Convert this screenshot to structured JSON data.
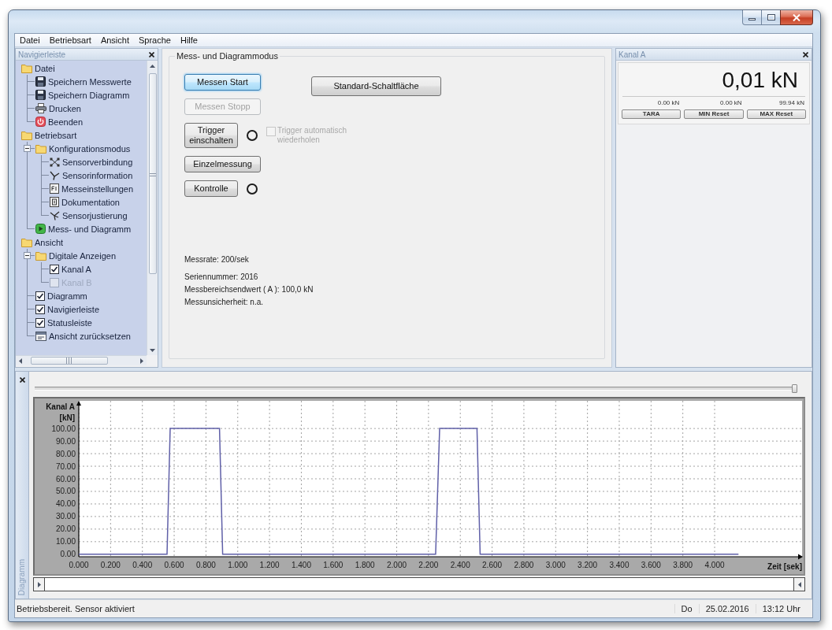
{
  "menu": [
    "Datei",
    "Betriebsart",
    "Ansicht",
    "Sprache",
    "Hilfe"
  ],
  "navigation": {
    "title": "Navigierleiste",
    "tree": [
      {
        "label": "Datei",
        "kind": "folder",
        "children": [
          {
            "label": "Speichern Messwerte",
            "kind": "save"
          },
          {
            "label": "Speichern Diagramm",
            "kind": "save"
          },
          {
            "label": "Drucken",
            "kind": "print"
          },
          {
            "label": "Beenden",
            "kind": "quit"
          }
        ]
      },
      {
        "label": "Betriebsart",
        "kind": "folder",
        "children": [
          {
            "label": "Konfigurationsmodus",
            "kind": "folder",
            "expanded": true,
            "children": [
              {
                "label": "Sensorverbindung",
                "kind": "connection"
              },
              {
                "label": "Sensorinformation",
                "kind": "information"
              },
              {
                "label": "Messeinstellungen",
                "kind": "settings"
              },
              {
                "label": "Dokumentation",
                "kind": "documentation"
              },
              {
                "label": "Sensorjustierung",
                "kind": "adjustment"
              }
            ]
          },
          {
            "label": "Mess- und Diagramm",
            "kind": "start"
          }
        ]
      },
      {
        "label": "Ansicht",
        "kind": "folder",
        "children": [
          {
            "label": "Digitale Anzeigen",
            "kind": "folder",
            "expanded": true,
            "children": [
              {
                "label": "Kanal A",
                "kind": "toggle",
                "checked": true,
                "disabled": false
              },
              {
                "label": "Kanal B",
                "kind": "toggle",
                "checked": false,
                "disabled": true
              }
            ]
          },
          {
            "label": "Diagramm",
            "kind": "toggle",
            "checked": true,
            "disabled": false
          },
          {
            "label": "Navigierleiste",
            "kind": "toggle",
            "checked": true,
            "disabled": false
          },
          {
            "label": "Statusleiste",
            "kind": "toggle",
            "checked": true,
            "disabled": false
          },
          {
            "label": "Ansicht zurücksetzen",
            "kind": "reset"
          }
        ]
      }
    ]
  },
  "mode_panel": {
    "title": "Mess- und Diagrammodus",
    "standard_button": "Standard-Schaltfläche",
    "controls": [
      {
        "kind": "button",
        "label": "Messen Start",
        "focused": true,
        "disabled": false
      },
      {
        "kind": "button",
        "label": "Messen Stopp",
        "focused": false,
        "disabled": true
      },
      {
        "kind": "trigger",
        "label": "Trigger einschalten",
        "focused": false,
        "disabled": false,
        "indicator_on": false,
        "option": {
          "label": "Trigger automatisch wiederholen",
          "checked": false,
          "disabled": true
        }
      },
      {
        "kind": "button",
        "label": "Einzelmessung",
        "focused": false,
        "disabled": false
      },
      {
        "kind": "indicator",
        "label": "Kontrolle",
        "focused": false,
        "disabled": false,
        "indicator_on": false
      }
    ],
    "rate": "Messrate: 200/sek",
    "details": [
      "Seriennummer: 2016",
      "Messbereichsendwert ( A ): 100,0 kN",
      "Messunsicherheit: n.a."
    ]
  },
  "channel_panel": {
    "title": "Kanal A",
    "reading": "0,01 kN",
    "stats": [
      {
        "value": "0.00 kN",
        "button": "TARA"
      },
      {
        "value": "0.00 kN",
        "button": "MIN Reset"
      },
      {
        "value": "99.94 kN",
        "button": "MAX Reset"
      }
    ]
  },
  "diagram": {
    "tab": "Diagramm",
    "slider": {
      "level": 1
    },
    "chart_data": {
      "type": "line",
      "grid": true,
      "xlabel": "Zeit [sek]",
      "ylabel": "Kanal A [kN]",
      "x": [
        0,
        0.555,
        0.575,
        0.885,
        0.905,
        2.245,
        2.27,
        2.505,
        2.525,
        4.15
      ],
      "series": [
        {
          "color": "#6060a8",
          "values": [
            0,
            0,
            100,
            100,
            0,
            0,
            100,
            100,
            0,
            0
          ]
        }
      ],
      "xlim": [
        0,
        4.55
      ],
      "ylim": [
        -2,
        122
      ],
      "xticks": [
        {
          "value": 0,
          "label": "0.000"
        },
        {
          "value": 0.2,
          "label": "0.200"
        },
        {
          "value": 0.4,
          "label": "0.400"
        },
        {
          "value": 0.6,
          "label": "0.600"
        },
        {
          "value": 0.8,
          "label": "0.800"
        },
        {
          "value": 1,
          "label": "1.000"
        },
        {
          "value": 1.2,
          "label": "1.200"
        },
        {
          "value": 1.4,
          "label": "1.400"
        },
        {
          "value": 1.6,
          "label": "1.600"
        },
        {
          "value": 1.8,
          "label": "1.800"
        },
        {
          "value": 2,
          "label": "2.000"
        },
        {
          "value": 2.2,
          "label": "2.200"
        },
        {
          "value": 2.4,
          "label": "2.400"
        },
        {
          "value": 2.6,
          "label": "2.600"
        },
        {
          "value": 2.8,
          "label": "2.800"
        },
        {
          "value": 3,
          "label": "3.000"
        },
        {
          "value": 3.2,
          "label": "3.200"
        },
        {
          "value": 3.4,
          "label": "3.400"
        },
        {
          "value": 3.6,
          "label": "3.600"
        },
        {
          "value": 3.8,
          "label": "3.800"
        },
        {
          "value": 4,
          "label": "4.000"
        }
      ],
      "yticks": [
        {
          "value": 0,
          "label": "0.00"
        },
        {
          "value": 10,
          "label": "10.00"
        },
        {
          "value": 20,
          "label": "20.00"
        },
        {
          "value": 30,
          "label": "30.00"
        },
        {
          "value": 40,
          "label": "40.00"
        },
        {
          "value": 50,
          "label": "50.00"
        },
        {
          "value": 60,
          "label": "60.00"
        },
        {
          "value": 70,
          "label": "70.00"
        },
        {
          "value": 80,
          "label": "80.00"
        },
        {
          "value": 90,
          "label": "90.00"
        },
        {
          "value": 100,
          "label": "100.00"
        }
      ]
    }
  },
  "status_bar": {
    "message": "Betriebsbereit. Sensor aktiviert",
    "day": "Do",
    "date": "25.02.2016",
    "time": "13:12 Uhr"
  }
}
